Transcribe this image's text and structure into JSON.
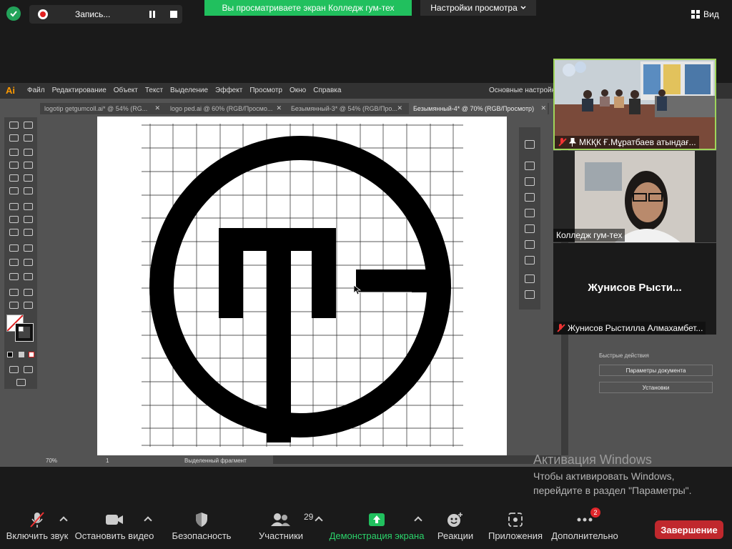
{
  "zoom_top": {
    "recording_label": "Запись...",
    "share_banner": "Вы просматриваете экран Колледж гум-тех",
    "view_settings": "Настройки просмотра",
    "view_button": "Вид"
  },
  "illustrator": {
    "logo": "Ai",
    "menu": [
      "Файл",
      "Редактирование",
      "Объект",
      "Текст",
      "Выделение",
      "Эффект",
      "Просмотр",
      "Окно",
      "Справка"
    ],
    "workspace": "Основные настройки",
    "tabs": [
      {
        "label": "logotip getgumcoll.ai* @ 54% (RG..."
      },
      {
        "label": "logo ped.ai @ 60% (RGB/Просмо..."
      },
      {
        "label": "Безымянный-3* @ 54% (RGB/Про..."
      },
      {
        "label": "Безымянный-4* @ 70% (RGB/Просмотр)"
      }
    ],
    "zoom_level": "70%",
    "page_number": "1",
    "status_text": "Выделенный фрагмент",
    "quick_actions": {
      "title": "Быстрые действия",
      "doc_params": "Параметры документа",
      "settings": "Установки"
    }
  },
  "participants": [
    {
      "name": "МКҚК Ғ.Мұратбаев атындағ...",
      "muted": true,
      "pinned": true
    },
    {
      "name": "Колледж гум-тех"
    },
    {
      "display_name": "Жунисов  Рысти...",
      "name": "Жунисов Рыстилла Алмахамбет...",
      "muted": true
    }
  ],
  "watermark": {
    "title": "Активация Windows",
    "line1": "Чтобы активировать Windows,",
    "line2": "перейдите в раздел \"Параметры\"."
  },
  "bottom_toolbar": {
    "unmute": "Включить звук",
    "stop_video": "Остановить видео",
    "security": "Безопасность",
    "participants": "Участники",
    "participants_count": "29",
    "share_screen": "Демонстрация экрана",
    "reactions": "Реакции",
    "apps": "Приложения",
    "more": "Дополнительно",
    "more_badge": "2",
    "end": "Завершение"
  }
}
